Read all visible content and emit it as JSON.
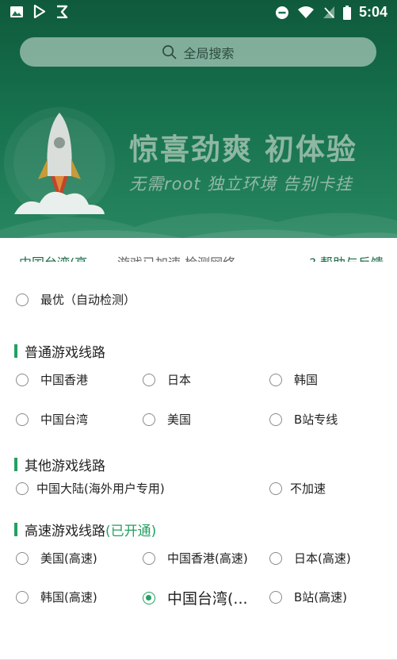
{
  "status_bar": {
    "time": "5:04",
    "left_icons": [
      "image-icon",
      "play-store-icon",
      "app-icon"
    ],
    "right_icons": [
      "dnd-icon",
      "wifi-icon",
      "signal-off-icon",
      "battery-icon"
    ]
  },
  "search": {
    "placeholder": "全局搜索"
  },
  "hero": {
    "title": "惊喜劲爽  初体验",
    "subtitle": "无需root  独立环境  告别卡挂"
  },
  "info_bar": {
    "region": "中国台湾(高",
    "status": "游戏已加速  检测网络",
    "help": "帮助与反馈"
  },
  "best_option": {
    "label": "最优（自动检测）"
  },
  "sections": [
    {
      "title": "普通游戏线路",
      "highlight": "",
      "options": [
        "中国香港",
        "日本",
        "韩国",
        "中国台湾",
        "美国",
        "B站专线"
      ]
    },
    {
      "title": "其他游戏线路",
      "highlight": "",
      "options": [
        "中国大陆(海外用户专用)",
        "不加速"
      ]
    },
    {
      "title": "高速游戏线路",
      "highlight": "(已开通)",
      "options": [
        "美国(高速)",
        "中国香港(高速)",
        "日本(高速)",
        "韩国(高速)",
        "中国台湾(...",
        "B站(高速)"
      ]
    }
  ],
  "selected": "中国台湾(...",
  "colors": {
    "accent": "#24a061",
    "header_green": "#17724e"
  }
}
